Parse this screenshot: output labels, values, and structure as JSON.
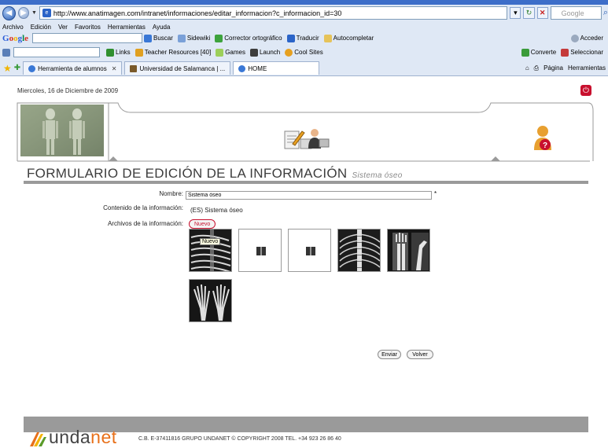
{
  "browser": {
    "url": "http://www.anatimagen.com/intranet/informaciones/editar_informacion?c_informacion_id=30",
    "search_placeholder": "Google",
    "menu": [
      "Archivo",
      "Edición",
      "Ver",
      "Favoritos",
      "Herramientas",
      "Ayuda"
    ],
    "google_toolbar": {
      "logo": "Google",
      "items": [
        "Buscar",
        "Sidewiki",
        "Corrector ortográfico",
        "Traducir",
        "Autocompletar"
      ],
      "right_items": [
        "Acceder"
      ]
    },
    "second_toolbar": {
      "items": [
        "Links",
        "Teacher Resources [40]",
        "Games",
        "Launch",
        "Cool Sites"
      ],
      "right_items": [
        "Converte",
        "Seleccionar"
      ]
    },
    "tabs": [
      {
        "label": "Herramienta de alumnos"
      },
      {
        "label": "Universidad de Salamanca | ..."
      },
      {
        "label": "HOME"
      }
    ],
    "tab_tools": [
      "Página",
      "Herramientas"
    ]
  },
  "page": {
    "date": "Miercoles, 16 de Diciembre de 2009",
    "form_title": "FORMULARIO DE EDICIÓN DE LA INFORMACIÓN",
    "form_subtitle": "Sistema óseo",
    "fields": {
      "name_label": "Nombre:",
      "name_value": "Sistema óseo",
      "required_mark": "*",
      "content_label": "Contenido de la información:",
      "content_value": "(ES) Sistema óseo",
      "files_label": "Archivos de la información:",
      "new_button": "Nuevo"
    },
    "tooltip": "Nuevo",
    "thumbnails": [
      {
        "name": "xray-ribs"
      },
      {
        "name": "book-placeholder"
      },
      {
        "name": "book-placeholder"
      },
      {
        "name": "xray-spine"
      },
      {
        "name": "xray-wrist"
      },
      {
        "name": "xray-feet"
      }
    ],
    "buttons": {
      "submit": "Enviar",
      "back": "Volver"
    },
    "footer": {
      "logo_part1": "unda",
      "logo_part2": "net",
      "text": "C.B. E-37411816 GRUPO UNDANET © COPYRIGHT 2008 TEL. +34 923 26 86 40"
    }
  },
  "colors": {
    "accent_red": "#c8102e",
    "rule_gray": "#9a9a9a",
    "logo_orange": "#e8701a"
  }
}
